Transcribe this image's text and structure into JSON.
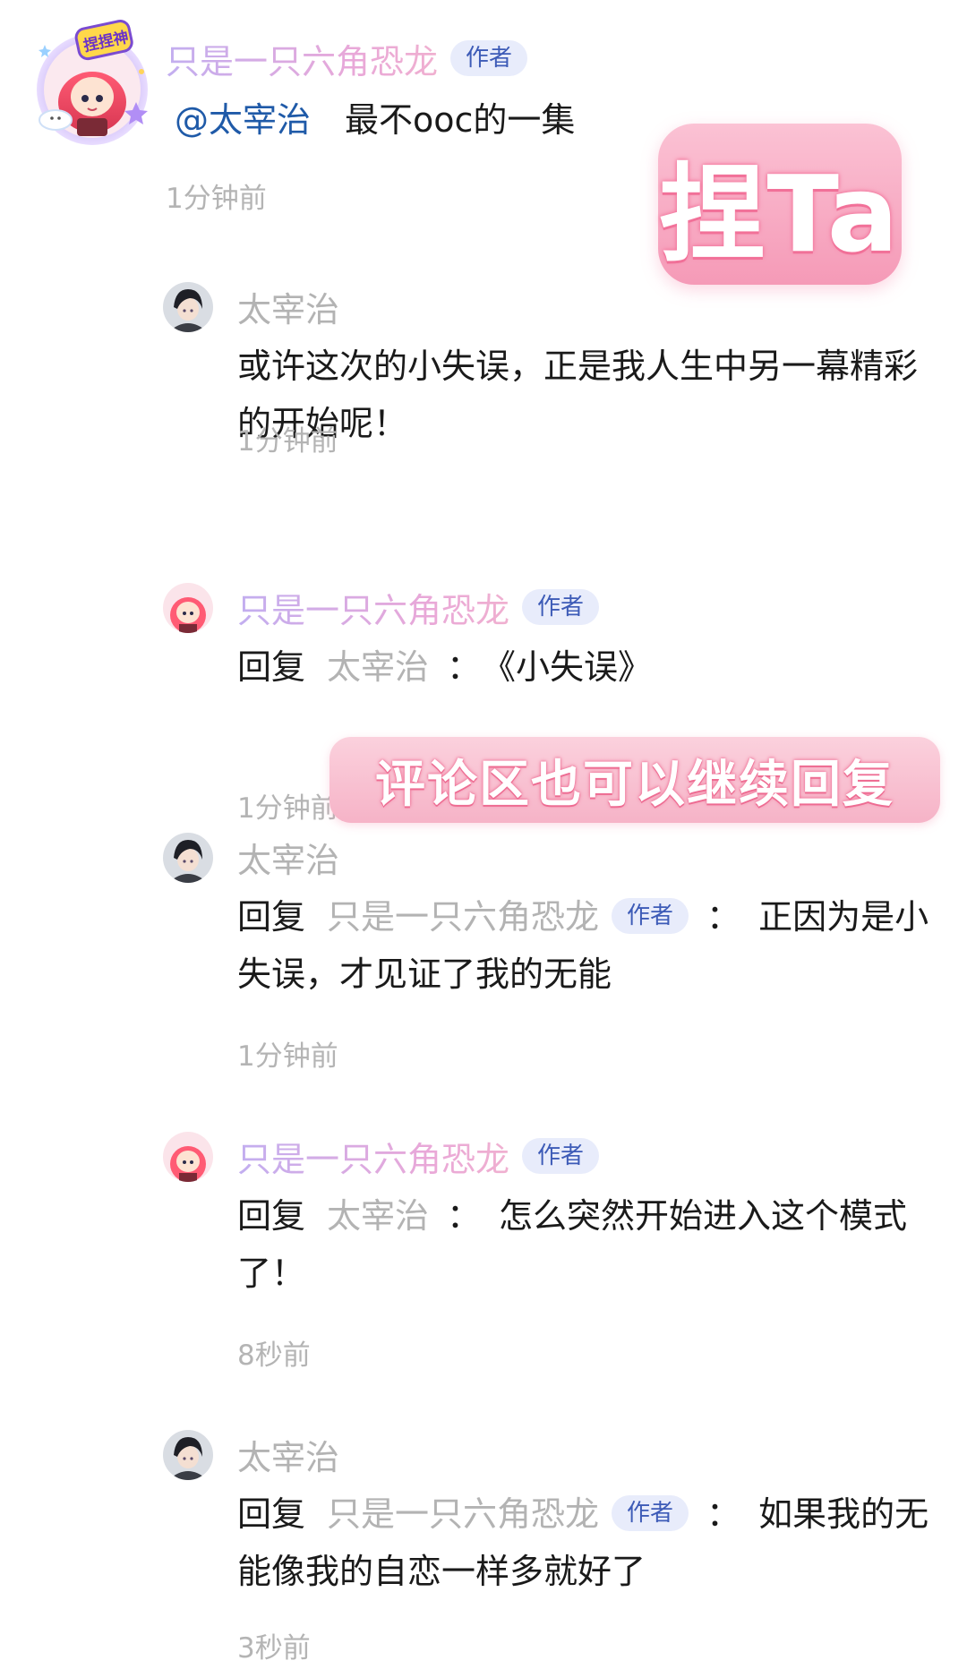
{
  "main_comment": {
    "author": "只是一只六角恐龙",
    "author_badge": "作者",
    "avatar_sticker_text": "捏捏神",
    "mention": "@太宰治",
    "text": "最不ooc的一集",
    "time": "1分钟前"
  },
  "replies": [
    {
      "author": "太宰治",
      "is_author": false,
      "text": "或许这次的小失误，正是我人生中另一幕精彩的开始呢！",
      "time": "1分钟前"
    },
    {
      "author": "只是一只六角恐龙",
      "is_author": true,
      "author_badge": "作者",
      "reply_prefix": "回复",
      "reply_to": "太宰治",
      "separator": "：",
      "text": "《小失误》",
      "time": "1分钟前"
    },
    {
      "author": "太宰治",
      "is_author": false,
      "reply_prefix": "回复",
      "reply_to": "只是一只六角恐龙",
      "reply_to_badge": "作者",
      "separator": "：",
      "text": "正因为是小失误，才见证了我的无能",
      "time": "1分钟前"
    },
    {
      "author": "只是一只六角恐龙",
      "is_author": true,
      "author_badge": "作者",
      "reply_prefix": "回复",
      "reply_to": "太宰治",
      "separator": "：",
      "text": "怎么突然开始进入这个模式了！",
      "time": "8秒前"
    },
    {
      "author": "太宰治",
      "is_author": false,
      "reply_prefix": "回复",
      "reply_to": "只是一只六角恐龙",
      "reply_to_badge": "作者",
      "separator": "：",
      "text": "如果我的无能像我的自恋一样多就好了",
      "time": "3秒前"
    }
  ],
  "overlays": {
    "poke_sticker": "捏Ta",
    "banner": "评论区也可以继续回复"
  },
  "colors": {
    "badge_bg": "#e8ecfb",
    "badge_text": "#3d5bb7",
    "mention": "#1f5aa8",
    "author_name": "#c2aef0",
    "muted": "#b3b3b3",
    "sticker_pink": "#f59ab7"
  }
}
